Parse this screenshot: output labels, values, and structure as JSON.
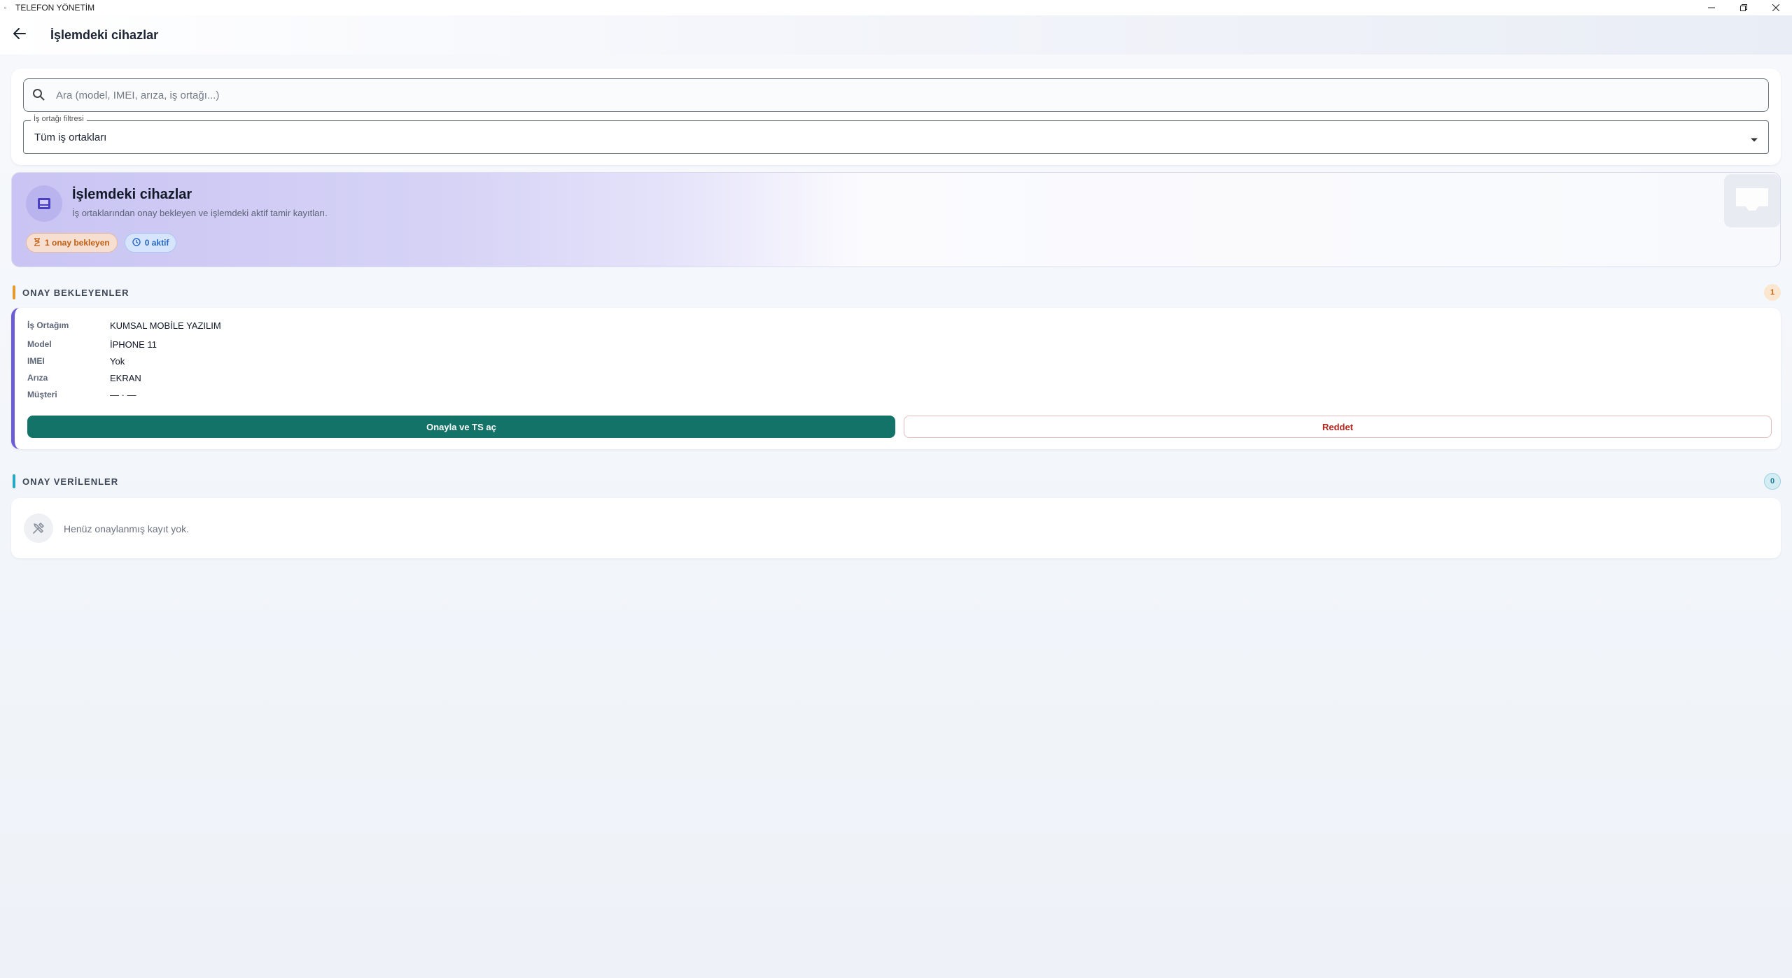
{
  "window": {
    "title": "TELEFON YÖNETİM",
    "icons": {
      "minimize": "minimize-icon",
      "maximize": "restore-icon",
      "close": "close-icon"
    }
  },
  "appbar": {
    "title": "İşlemdeki cihazlar",
    "back_icon": "arrow-left-icon"
  },
  "filters": {
    "search_placeholder": "Ara (model, IMEI, arıza, iş ortağı...)",
    "search_value": "",
    "partner_label": "İş ortağı filtresi",
    "partner_value": "Tüm iş ortakları"
  },
  "hero": {
    "title": "İşlemdeki cihazlar",
    "subtitle": "İş ortaklarından onay bekleyen ve işlemdeki aktif tamir kayıtları.",
    "chip_pending": "1 onay bekleyen",
    "chip_active": "0 aktif",
    "accent": "#6b5cd6"
  },
  "pending_section": {
    "label": "ONAY BEKLEYENLER",
    "count": "1",
    "color": "#e49a2f"
  },
  "pending_item": {
    "fields": [
      {
        "key": "İş Ortağım",
        "value": "KUMSAL MOBİLE YAZILIM"
      },
      {
        "key": "Model",
        "value": "İPHONE 11"
      },
      {
        "key": "IMEI",
        "value": "Yok"
      },
      {
        "key": "Arıza",
        "value": "EKRAN"
      },
      {
        "key": "Müşteri",
        "value": "— · —"
      }
    ],
    "approve_label": "Onayla ve TS aç",
    "reject_label": "Reddet",
    "approve_color": "#147368",
    "reject_color": "#b3261e"
  },
  "approved_section": {
    "label": "ONAY VERİLENLER",
    "count": "0",
    "color": "#2aa7c4",
    "empty_text": "Henüz onaylanmış kayıt yok."
  }
}
